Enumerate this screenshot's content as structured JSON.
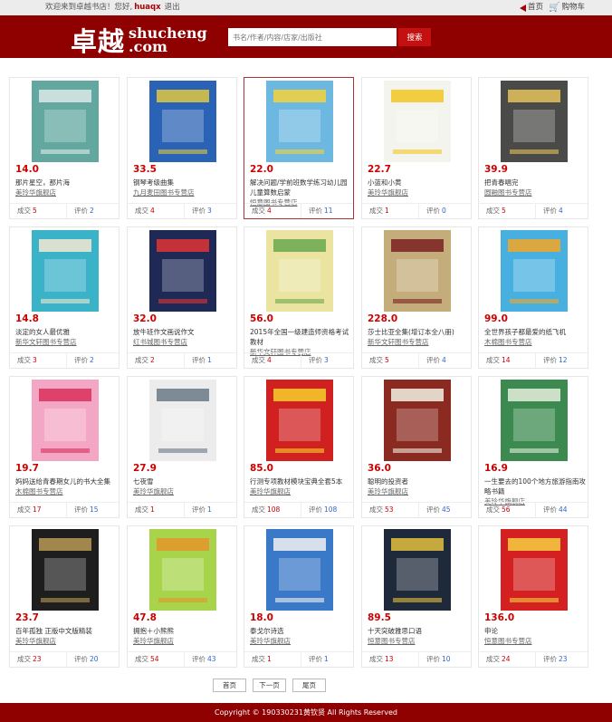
{
  "topbar": {
    "welcome": "欢迎来到卓越书店！您好,",
    "username": "huaqx",
    "logout": "退出",
    "home": "首页",
    "cart": "购物车"
  },
  "header": {
    "logo_cn": "卓越",
    "logo_en_1": "shucheng",
    "logo_en_2": ".com",
    "search_placeholder": "书名/作者/内容/店家/出版社",
    "search_button": "搜索"
  },
  "stat_labels": {
    "deals": "成交",
    "reviews": "评价"
  },
  "books": [
    {
      "price": "14.0",
      "title": "那片星空，那片海",
      "shop": "美玲华旗舰店",
      "deals": "5",
      "reviews": "2",
      "cover": "#62a8a0",
      "accent": "#dde9e5"
    },
    {
      "price": "33.5",
      "title": "钢琴考级曲集",
      "shop": "九月麦田图书专营店",
      "deals": "4",
      "reviews": "3",
      "cover": "#2a63b5",
      "accent": "#e0c640"
    },
    {
      "price": "22.0",
      "title": "解决问题/学前班数学练习幼儿园儿童算数启蒙",
      "shop": "恒意图书专营店",
      "deals": "4",
      "reviews": "11",
      "cover": "#6cb8e0",
      "accent": "#f4d23a",
      "selected": true
    },
    {
      "price": "22.7",
      "title": "小蓝和小黄",
      "shop": "美玲华旗舰店",
      "deals": "1",
      "reviews": "0",
      "cover": "#f4f4ee",
      "accent": "#f2c621"
    },
    {
      "price": "39.9",
      "title": "把青春唱完",
      "shop": "圆融图书专营店",
      "deals": "5",
      "reviews": "4",
      "cover": "#4a4a48",
      "accent": "#e5c25c"
    },
    {
      "price": "14.8",
      "title": "淡定的女人最优雅",
      "shop": "新华文轩图书专营店",
      "deals": "3",
      "reviews": "2",
      "cover": "#3ab2c8",
      "accent": "#f5e7d0"
    },
    {
      "price": "32.0",
      "title": "放牛班作文画说作文",
      "shop": "红书城图书专营店",
      "deals": "2",
      "reviews": "1",
      "cover": "#1e2a55",
      "accent": "#e03434"
    },
    {
      "price": "56.0",
      "title": "2015年全国一级建造师资格考试教材",
      "shop": "新华文轩图书专营店",
      "deals": "4",
      "reviews": "3",
      "cover": "#eae4a0",
      "accent": "#6aa84f"
    },
    {
      "price": "228.0",
      "title": "莎士比亚全集(增订本全八册)",
      "shop": "新华文轩图书专营店",
      "deals": "5",
      "reviews": "4",
      "cover": "#c4ad7a",
      "accent": "#7a2020"
    },
    {
      "price": "99.0",
      "title": "全世界孩子都最爱的纸飞机",
      "shop": "木棉图书专营店",
      "deals": "14",
      "reviews": "12",
      "cover": "#48b0e0",
      "accent": "#f5a623"
    },
    {
      "price": "19.7",
      "title": "妈妈送给青春期女儿的书大全集",
      "shop": "木棉图书专营店",
      "deals": "17",
      "reviews": "15",
      "cover": "#f3a7c4",
      "accent": "#d9305a"
    },
    {
      "price": "27.9",
      "title": "七夜雪",
      "shop": "美玲华旗舰店",
      "deals": "1",
      "reviews": "1",
      "cover": "#ececec",
      "accent": "#6a7a88"
    },
    {
      "price": "85.0",
      "title": "行测专项教材模块宝典全套5本",
      "shop": "美玲华旗舰店",
      "deals": "108",
      "reviews": "108",
      "cover": "#d02020",
      "accent": "#f6d12a"
    },
    {
      "price": "36.0",
      "title": "聪明的投资者",
      "shop": "美玲华旗舰店",
      "deals": "53",
      "reviews": "45",
      "cover": "#8a2a20",
      "accent": "#f2f2e6"
    },
    {
      "price": "16.9",
      "title": "一生要去的100个地方旅游指南攻略书籍",
      "shop": "美玲华旗舰店",
      "deals": "56",
      "reviews": "44",
      "cover": "#3c8a50",
      "accent": "#e5eedd"
    },
    {
      "price": "23.7",
      "title": "百年孤独 正版中文版精装",
      "shop": "美玲华旗舰店",
      "deals": "23",
      "reviews": "20",
      "cover": "#1e1e1e",
      "accent": "#b89a55"
    },
    {
      "price": "47.8",
      "title": "拥抱＋小熊熊",
      "shop": "美玲华旗舰店",
      "deals": "54",
      "reviews": "43",
      "cover": "#a7d44a",
      "accent": "#e5952a"
    },
    {
      "price": "18.0",
      "title": "泰戈尔诗选",
      "shop": "美玲华旗舰店",
      "deals": "1",
      "reviews": "1",
      "cover": "#3a78c8",
      "accent": "#f2f2f2"
    },
    {
      "price": "89.5",
      "title": "十天突破雅思口语",
      "shop": "恒意图书专营店",
      "deals": "13",
      "reviews": "10",
      "cover": "#1e2a3a",
      "accent": "#e4c040"
    },
    {
      "price": "136.0",
      "title": "申论",
      "shop": "恒意图书专营店",
      "deals": "24",
      "reviews": "23",
      "cover": "#d42020",
      "accent": "#f4d040"
    }
  ],
  "pager": {
    "first": "首页",
    "next": "下一页",
    "last": "尾页"
  },
  "footer": {
    "copyright": "Copyright © 190330231黄钦贤 All Rights Reserved"
  }
}
